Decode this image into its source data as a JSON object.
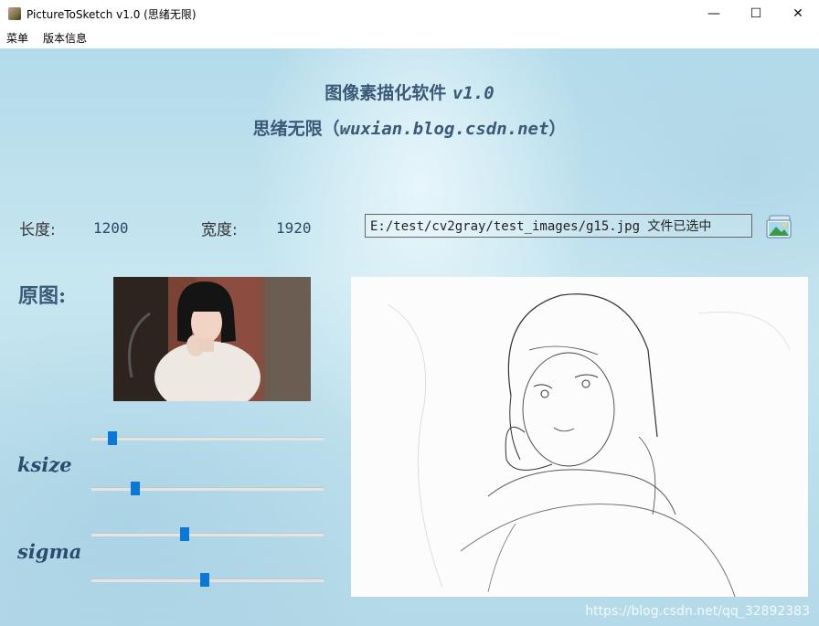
{
  "window": {
    "title": "PictureToSketch v1.0 (思绪无限)",
    "controls": {
      "minimize": "—",
      "maximize": "☐",
      "close": "✕"
    }
  },
  "menu": {
    "items": [
      "菜单",
      "版本信息"
    ]
  },
  "header": {
    "line1_prefix": "图像素描化软件 ",
    "line1_version": "v1.0",
    "line2_prefix": "思绪无限（",
    "line2_url": "wuxian.blog.csdn.net",
    "line2_suffix": "）"
  },
  "info": {
    "length_label": "长度:",
    "length_value": "1200",
    "width_label": "宽度:",
    "width_value": "1920",
    "file_path": "E:/test/cv2gray/test_images/g15.jpg 文件已选中"
  },
  "original": {
    "label": "原图:"
  },
  "controls": {
    "ksize_label": "ksize",
    "sigma_label": "sigma",
    "sliders": [
      {
        "name": "ksize-slider-1",
        "value": 0.09
      },
      {
        "name": "ksize-slider-2",
        "value": 0.19
      },
      {
        "name": "sigma-slider-1",
        "value": 0.4
      },
      {
        "name": "sigma-slider-2",
        "value": 0.49
      }
    ]
  },
  "watermark": "https://blog.csdn.net/qq_32892383",
  "icons": {
    "app": "app-icon",
    "open_file": "image-folder-icon"
  }
}
